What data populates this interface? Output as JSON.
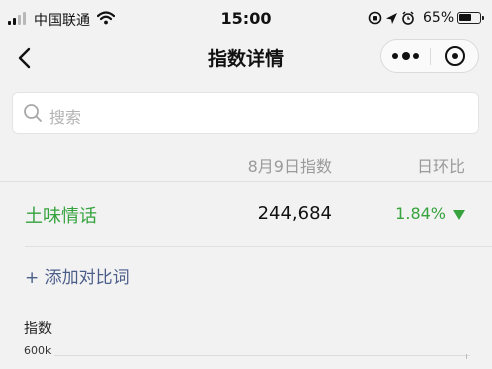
{
  "status_bar": {
    "carrier": "中国联通",
    "time": "15:00",
    "battery": "65%",
    "battery_level": 0.65,
    "signal_bars_filled": 2,
    "signal_bars_total": 4
  },
  "nav": {
    "title": "指数详情"
  },
  "search": {
    "placeholder": "搜索"
  },
  "table": {
    "date_header": "8月9日指数",
    "change_header": "日环比",
    "rows": [
      {
        "keyword": "土味情话",
        "index": "244,684",
        "change": "1.84%",
        "trend": "down"
      }
    ]
  },
  "add_compare": "+ 添加对比词",
  "chart": {
    "label": "指数",
    "y_tick_top": "600k"
  },
  "colors": {
    "accent_green": "#36a33f",
    "link_blue": "#4b5e8a",
    "background": "#f2f2f2"
  }
}
